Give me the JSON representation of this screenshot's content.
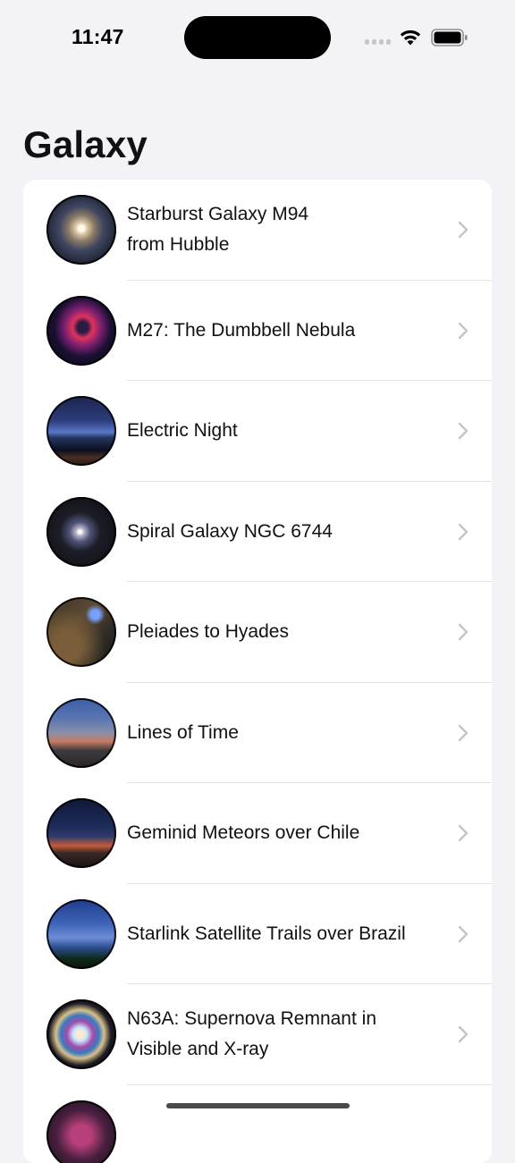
{
  "status_bar": {
    "time": "11:47",
    "icons": [
      "cellular-signal-icon",
      "wifi-icon",
      "battery-icon"
    ]
  },
  "title": "Galaxy",
  "items": [
    {
      "label_line1": "Starburst Galaxy M94",
      "label_line2": "from Hubble"
    },
    {
      "label_line1": "M27: The Dumbbell Nebula",
      "label_line2": ""
    },
    {
      "label_line1": "Electric Night",
      "label_line2": ""
    },
    {
      "label_line1": "Spiral Galaxy NGC 6744",
      "label_line2": ""
    },
    {
      "label_line1": "Pleiades to Hyades",
      "label_line2": ""
    },
    {
      "label_line1": "Lines of Time",
      "label_line2": ""
    },
    {
      "label_line1": "Geminid Meteors over Chile",
      "label_line2": ""
    },
    {
      "label_line1": "Starlink Satellite Trails over Brazil",
      "label_line2": ""
    },
    {
      "label_line1": "N63A: Supernova Remnant in",
      "label_line2": "Visible and X-ray"
    },
    {
      "label_line1": "",
      "label_line2": ""
    }
  ],
  "colors": {
    "background": "#f2f2f7",
    "card": "#ffffff",
    "chevron": "#c4c4c7",
    "text": "#111111"
  }
}
